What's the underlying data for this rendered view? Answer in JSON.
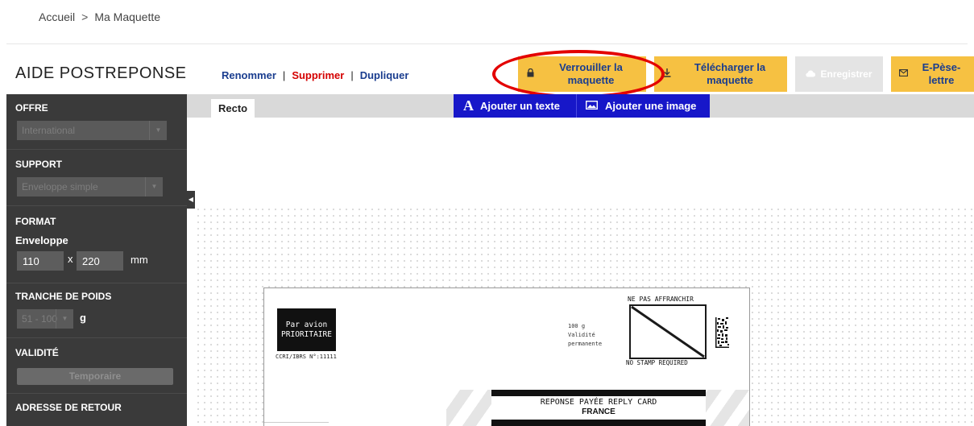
{
  "breadcrumb": {
    "home": "Accueil",
    "separator": ">",
    "current": "Ma Maquette"
  },
  "app": {
    "title": "AIDE POSTREPONSE"
  },
  "actions": {
    "rename": "Renommer",
    "delete": "Supprimer",
    "duplicate": "Dupliquer",
    "separator": "|"
  },
  "buttons": {
    "lock_line1": "Verrouiller la",
    "lock_line2": "maquette",
    "download_line1": "Télécharger la",
    "download_line2": "maquette",
    "save": "Enregistrer",
    "eweigh_line1": "E-Pèse-",
    "eweigh_line2": "lettre"
  },
  "sidebar": {
    "offre": {
      "title": "OFFRE",
      "value": "International"
    },
    "support": {
      "title": "SUPPORT",
      "value": "Enveloppe simple"
    },
    "format": {
      "title": "FORMAT",
      "subtitle": "Enveloppe",
      "width": "110",
      "x": "x",
      "height": "220",
      "unit": "mm"
    },
    "poids": {
      "title": "TRANCHE DE POIDS",
      "value": "51 - 100",
      "unit": "g"
    },
    "validite": {
      "title": "VALIDITÉ",
      "value": "Temporaire"
    },
    "adresse": {
      "title": "ADRESSE DE RETOUR"
    }
  },
  "canvas": {
    "tab": "Recto",
    "add_text": "Ajouter un texte",
    "add_image": "Ajouter une image"
  },
  "envelope": {
    "par_avion_1": "Par avion",
    "par_avion_2": "PRIORITAIRE",
    "ccri": "CCRI/IBRS N°:11111",
    "weight": "100 g",
    "validity_1": "Validité",
    "validity_2": "permanente",
    "ne_pas": "NE PAS AFFRANCHIR",
    "no_stamp": "NO STAMP REQUIRED",
    "reply": "REPONSE PAYÉE REPLY CARD",
    "country": "FRANCE"
  },
  "colors": {
    "accent_yellow": "#f6c142",
    "link_blue": "#1a3d8f",
    "delete_red": "#d40000",
    "sidebar_bg": "#3a3a3a",
    "toolbar_blue": "#1717c9",
    "highlight_oval": "#e30000"
  }
}
